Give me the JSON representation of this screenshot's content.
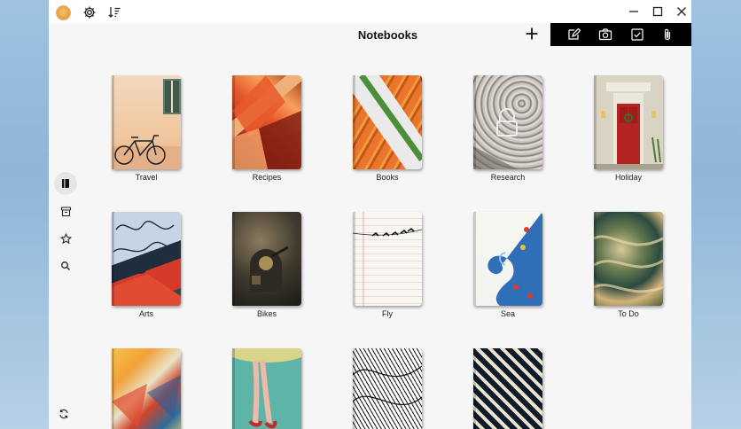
{
  "app": {
    "title": "Notebooks"
  },
  "titlebar": {
    "avatar": "avatar",
    "settings_icon": "gear-icon",
    "sort_icon": "sort-icon",
    "controls": [
      "minimize",
      "maximize",
      "close"
    ]
  },
  "toolbar": {
    "add_icon": "plus-icon",
    "quick_actions": [
      "edit-note-icon",
      "camera-icon",
      "checkbox-icon",
      "attachment-icon"
    ]
  },
  "sidebar": {
    "items": [
      "notebooks-icon",
      "trash-icon",
      "star-icon",
      "search-icon"
    ],
    "bottom": "sync-icon"
  },
  "notebooks": [
    {
      "label": "Travel"
    },
    {
      "label": "Recipes"
    },
    {
      "label": "Books"
    },
    {
      "label": "Research"
    },
    {
      "label": "Holiday"
    },
    {
      "label": "Arts"
    },
    {
      "label": "Bikes"
    },
    {
      "label": "Fly"
    },
    {
      "label": "Sea"
    },
    {
      "label": "To Do"
    },
    {
      "label": ""
    },
    {
      "label": ""
    },
    {
      "label": ""
    },
    {
      "label": ""
    }
  ],
  "colors": {
    "window_bg": "#f6f6f6",
    "accent_bar": "#000000",
    "desktop": "#9fc2e0"
  }
}
